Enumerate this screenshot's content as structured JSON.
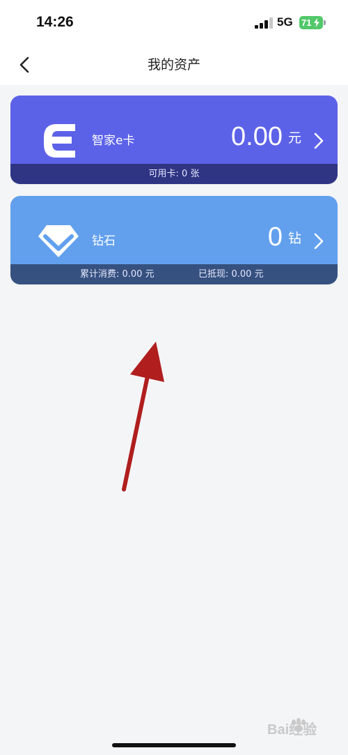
{
  "status_bar": {
    "time": "14:26",
    "network": "5G",
    "battery": "71",
    "battery_color": "#52c86a"
  },
  "nav": {
    "back_icon": "chevron-left-icon",
    "title": "我的资产"
  },
  "cards": [
    {
      "id": "e-card",
      "icon": "e-letter-icon",
      "label": "智家e卡",
      "amount": "0.00",
      "unit": "元",
      "color": "#5c62e8",
      "footer_color": "#2f3483",
      "footer": {
        "available": "可用卡: 0 张"
      }
    },
    {
      "id": "diamond",
      "icon": "diamond-icon",
      "label": "钻石",
      "amount": "0",
      "unit": "钻",
      "color": "#62a0ee",
      "footer_color": "#36517f",
      "footer": {
        "cumulative": "累计消费: 0.00 元",
        "redeemed": "已抵现: 0.00 元"
      }
    }
  ],
  "overlay": {
    "annotation_arrow_color": "#b01e1e"
  },
  "watermark": {
    "text": "Bai经验",
    "icon": "baidu-paw-icon"
  }
}
